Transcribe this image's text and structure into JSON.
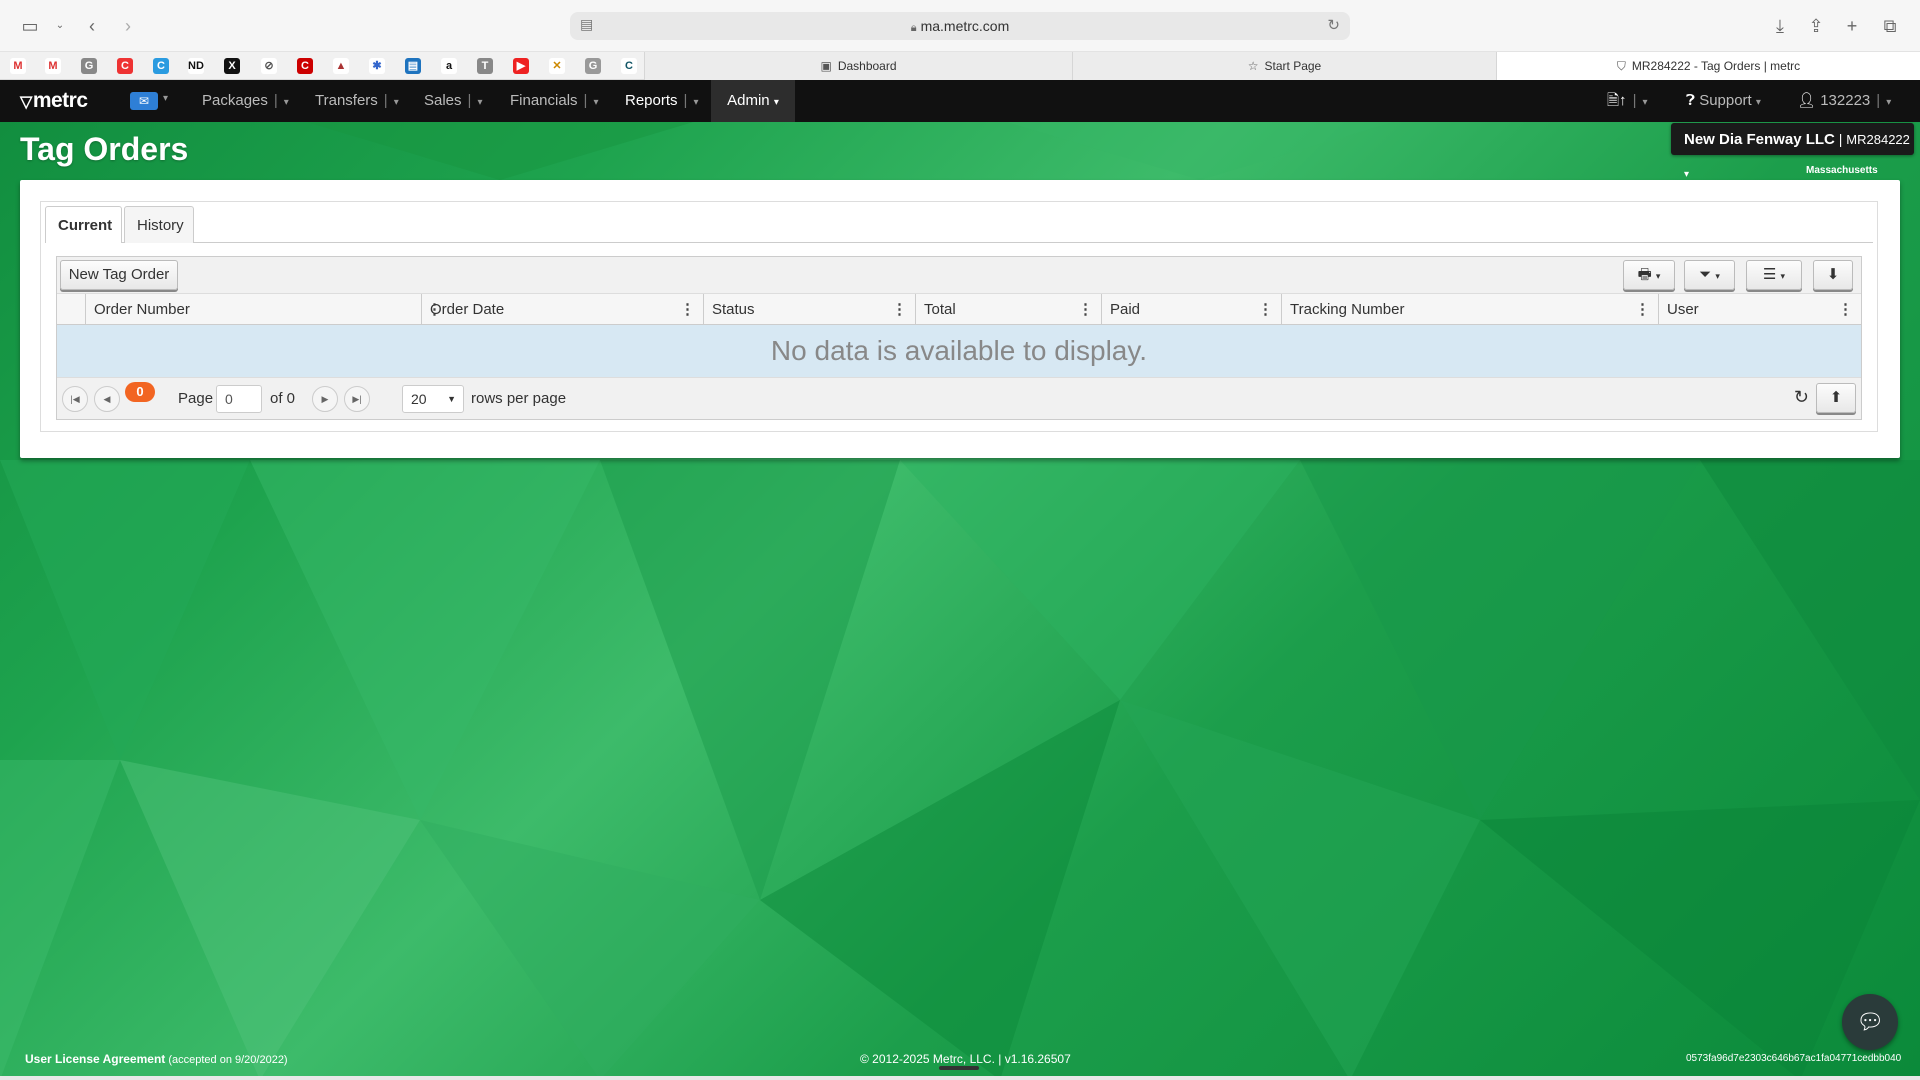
{
  "browser": {
    "url": "ma.metrc.com",
    "tabs": [
      {
        "label": "Dashboard"
      },
      {
        "label": "Start Page"
      },
      {
        "label": "MR284222 - Tag Orders | metrc"
      }
    ]
  },
  "nav": {
    "logo": "metrc",
    "items": [
      {
        "label": "Packages"
      },
      {
        "label": "Transfers"
      },
      {
        "label": "Sales"
      },
      {
        "label": "Financials"
      },
      {
        "label": "Reports"
      },
      {
        "label": "Admin"
      }
    ],
    "support": "Support",
    "user": "132223"
  },
  "page": {
    "title": "Tag Orders",
    "facility_name": "New Dia Fenway LLC",
    "facility_license": "MR284222",
    "state": "Massachusetts"
  },
  "tabs": [
    {
      "label": "Current",
      "active": true
    },
    {
      "label": "History",
      "active": false
    }
  ],
  "grid": {
    "new_button": "New Tag Order",
    "columns": [
      "Order Number",
      "Order Date",
      "Status",
      "Total",
      "Paid",
      "Tracking Number",
      "User"
    ],
    "empty_message": "No data is available to display.",
    "pager": {
      "count_badge": "0",
      "page_label": "Page",
      "page_value": "0",
      "of_label": "of 0",
      "rows_value": "20",
      "rows_label": "rows per page"
    }
  },
  "footer": {
    "license_link": "User License Agreement",
    "license_note": "(accepted on 9/20/2022)",
    "copyright": "© 2012-2025 Metrc, LLC. | v1.16.26507",
    "hash": "0573fa96d7e2303c646b67ac1fa04771cedbb040"
  },
  "colors": {
    "navbar": "#111111",
    "badge": "#f26522",
    "empty_row": "#d7e8f3",
    "background": "#1ea34e"
  }
}
